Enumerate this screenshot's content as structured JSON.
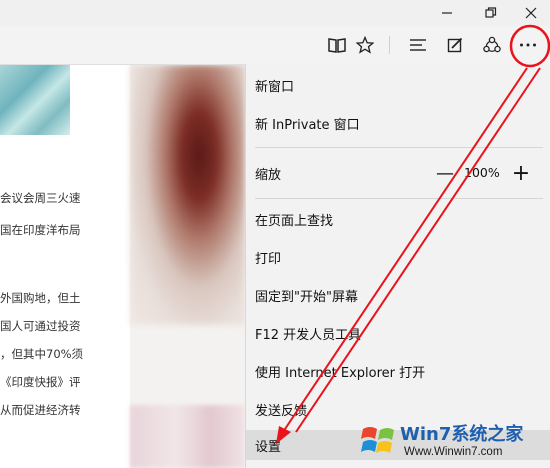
{
  "menu": {
    "items": [
      {
        "label": "新窗口"
      },
      {
        "label": "新 InPrivate 窗口"
      },
      {
        "label": "缩放"
      },
      {
        "label": "在页面上查找"
      },
      {
        "label": "打印"
      },
      {
        "label": "固定到\"开始\"屏幕"
      },
      {
        "label": "F12 开发人员工具"
      },
      {
        "label": "使用 Internet Explorer 打开"
      },
      {
        "label": "发送反馈"
      },
      {
        "label": "设置"
      }
    ],
    "zoom": {
      "minus": "—",
      "value": "100%",
      "plus": "+"
    }
  },
  "article": {
    "lines": [
      "会议会周三火速",
      "国在印度洋布局",
      "外国购地，但土",
      "国人可通过投资",
      "，但其中70%须",
      "《印度快报》评",
      "从而促进经济转"
    ]
  },
  "toolbar": {
    "icons": [
      "reading-view-icon",
      "favorite-star-icon",
      "hub-icon",
      "web-note-icon",
      "share-icon",
      "more-actions-icon"
    ]
  },
  "watermark": {
    "title": "Win7系统之家",
    "url": "Www.Winwin7.com"
  },
  "colors": {
    "annotation": "#e8141b",
    "menu_bg": "#f2f2f2",
    "menu_hover": "#dcdcdc",
    "watermark_blue": "#1e5fb0"
  }
}
